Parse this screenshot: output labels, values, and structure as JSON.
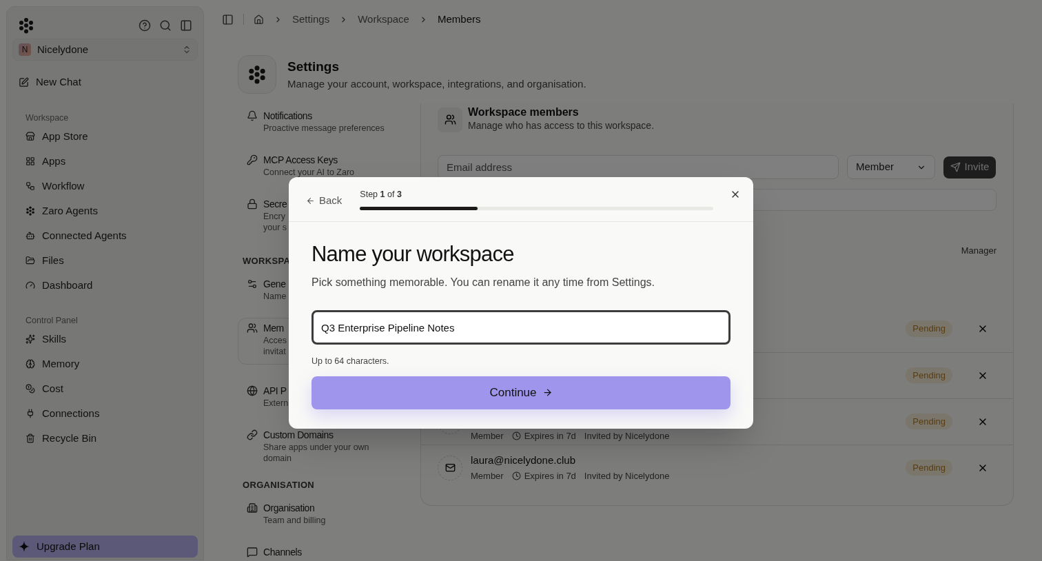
{
  "sidebar": {
    "workspace_switcher": {
      "initial": "N",
      "name": "Nicelydone"
    },
    "new_chat": "New Chat",
    "sections": [
      {
        "heading": "Workspace",
        "items": [
          "App Store",
          "Apps",
          "Workflow",
          "Zaro Agents",
          "Connected Agents",
          "Files",
          "Dashboard"
        ]
      },
      {
        "heading": "Control Panel",
        "items": [
          "Skills",
          "Memory",
          "Cost",
          "Connections",
          "Recycle Bin"
        ]
      }
    ],
    "upgrade": "Upgrade Plan"
  },
  "breadcrumb": [
    "Settings",
    "Workspace",
    "Members"
  ],
  "settings": {
    "title": "Settings",
    "subtitle": "Manage your account, workspace, integrations, and organisation."
  },
  "settings_nav": [
    {
      "items": [
        {
          "title": "Notifications",
          "desc_lines": [
            "Proactive message preferences"
          ],
          "selected": false
        },
        {
          "title": "MCP Access Keys",
          "desc_lines": [
            "Connect your AI to Zaro"
          ],
          "selected": false
        },
        {
          "title": "Secre",
          "desc_lines": [
            "Encry",
            "your s"
          ],
          "selected": false
        }
      ]
    },
    {
      "heading": "WORKSPA",
      "items": [
        {
          "title": "Gene",
          "desc_lines": [
            "Name"
          ],
          "selected": false
        },
        {
          "title": "Mem",
          "desc_lines": [
            "Acces",
            "invitat"
          ],
          "selected": true
        },
        {
          "title": "API P",
          "desc_lines": [
            "Extern"
          ],
          "selected": false
        },
        {
          "title": "Custom Domains",
          "desc_lines": [
            "Share apps under your own",
            "domain"
          ],
          "selected": false
        }
      ]
    },
    {
      "heading": "ORGANISATION",
      "items": [
        {
          "title": "Organisation",
          "desc_lines": [
            "Team and billing"
          ],
          "selected": false
        },
        {
          "title": "Channels",
          "selected": false
        }
      ]
    }
  ],
  "members": {
    "title": "Workspace members",
    "subtitle": "Manage who has access to this workspace.",
    "email_placeholder": "Email address",
    "role": "Member",
    "invite": "Invite",
    "owner_role": "Manager",
    "invites": [
      {
        "status": "Pending"
      },
      {
        "status": "Pending"
      },
      {
        "role": "Member",
        "expires": "Expires in 7d",
        "invited_by": "Invited by Nicelydone",
        "status": "Pending"
      },
      {
        "email": "laura@nicelydone.club",
        "role": "Member",
        "expires": "Expires in 7d",
        "invited_by": "Invited by Nicelydone",
        "status": "Pending"
      }
    ]
  },
  "modal": {
    "back": "Back",
    "step": "Step **1** of **3**",
    "level": 0.333,
    "title": "Name your workspace",
    "subtitle": "Pick something memorable. You can rename it any time from Settings.",
    "value": "Q3 Enterprise Pipeline Notes",
    "hint": "Up to 64 characters.",
    "continue": "Continue"
  }
}
